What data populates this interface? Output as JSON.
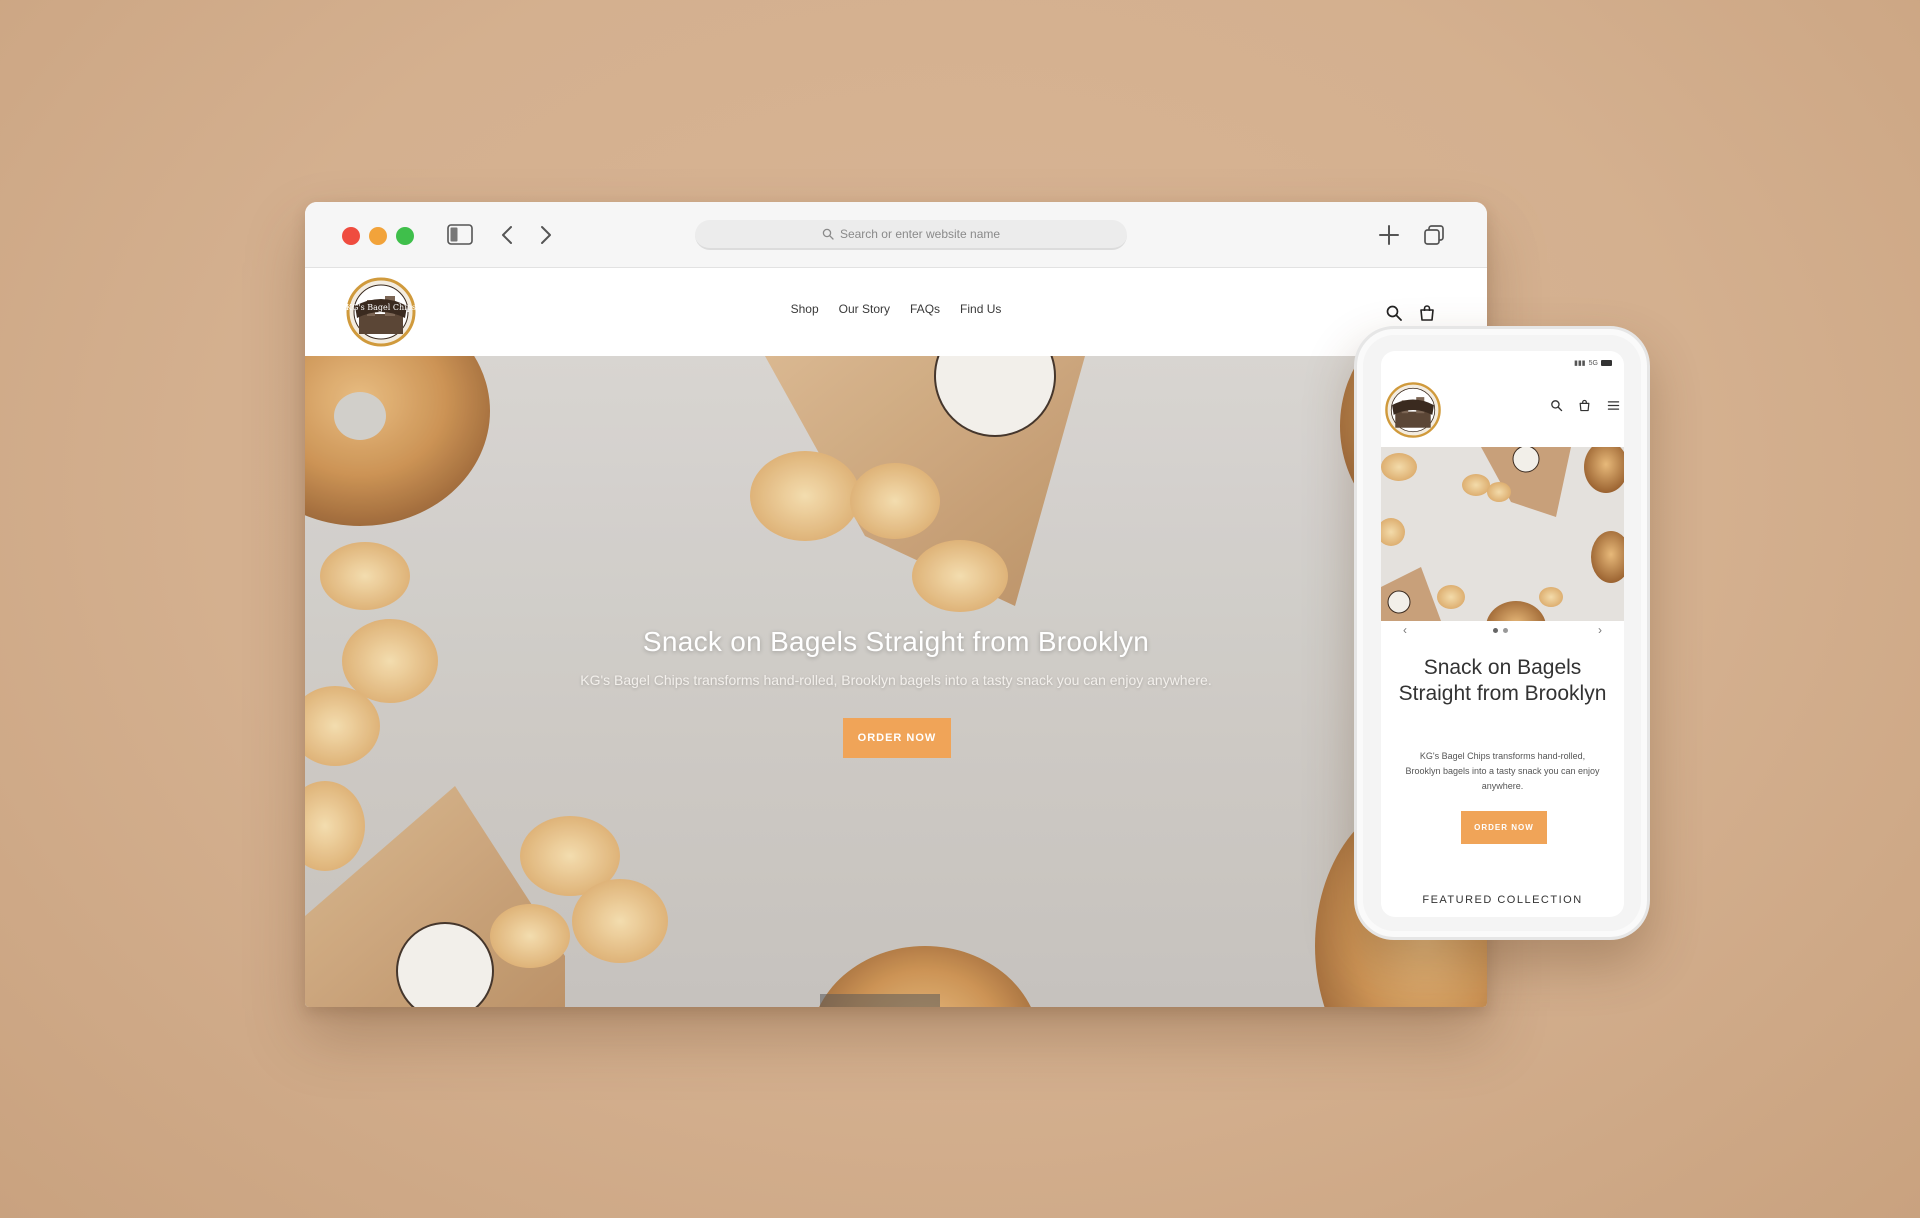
{
  "browser": {
    "address_placeholder": "Search or enter website name",
    "icons": [
      "sidebar-icon",
      "back-arrow-icon",
      "forward-arrow-icon",
      "search-icon",
      "new-tab-plus-icon",
      "tabs-overview-icon"
    ],
    "traffic_lights": {
      "close": "#ef4c3f",
      "minimize": "#f2a33a",
      "zoom": "#3fbf4b"
    }
  },
  "site": {
    "logo_text": "KG's Bagel Chips",
    "nav": [
      "Shop",
      "Our Story",
      "FAQs",
      "Find Us"
    ],
    "hero": {
      "title": "Snack on Bagels Straight from Brooklyn",
      "subtitle": "KG's Bagel Chips transforms hand-rolled, Brooklyn bagels into a tasty snack you can enjoy anywhere.",
      "cta": "ORDER NOW"
    },
    "accent_color": "#f0a458"
  },
  "mobile": {
    "title": "Snack on Bagels Straight from Brooklyn",
    "subtitle": "KG's Bagel Chips transforms hand-rolled, Brooklyn bagels into a tasty snack you can enjoy anywhere.",
    "cta": "ORDER NOW",
    "featured": "FEATURED COLLECTION",
    "status_network": "5G"
  }
}
